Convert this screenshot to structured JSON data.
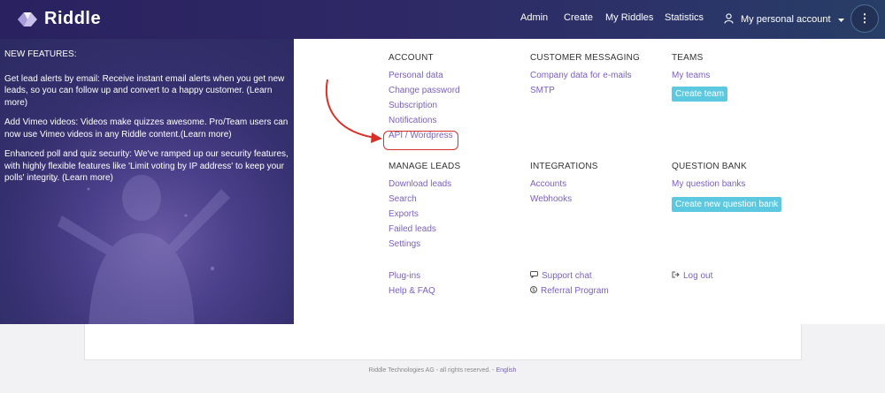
{
  "header": {
    "brand": "Riddle",
    "nav": [
      "Admin",
      "Create",
      "My Riddles",
      "Statistics"
    ],
    "account_label": "My personal account",
    "more_icon": "⋮"
  },
  "promo": {
    "title": "NEW FEATURES:",
    "items": [
      "Get lead alerts by email: Receive instant email alerts when you get new leads, so you can follow up and convert to a happy customer. (Learn more)",
      "Add Vimeo videos: Videos make quizzes awesome. Pro/Team users can now use Vimeo videos in any Riddle content.(Learn more)",
      "Enhanced poll and quiz security: We've ramped up our security features, with highly flexible features like 'Limit voting by IP address' to keep your polls' integrity. (Learn more)"
    ]
  },
  "menu": {
    "account": {
      "title": "ACCOUNT",
      "links": [
        "Personal data",
        "Change password",
        "Subscription",
        "Notifications",
        "API / Wordpress"
      ]
    },
    "messaging": {
      "title": "CUSTOMER MESSAGING",
      "links": [
        "Company data for e-mails",
        "SMTP"
      ]
    },
    "teams": {
      "title": "TEAMS",
      "links": [
        "My teams"
      ],
      "button": "Create team"
    },
    "leads": {
      "title": "MANAGE LEADS",
      "links": [
        "Download leads",
        "Search",
        "Exports",
        "Failed leads",
        "Settings"
      ]
    },
    "integrations": {
      "title": "INTEGRATIONS",
      "links": [
        "Accounts",
        "Webhooks"
      ]
    },
    "question_bank": {
      "title": "QUESTION BANK",
      "links": [
        "My question banks"
      ],
      "button": "Create new question bank"
    },
    "bottom": {
      "plugins": "Plug-ins",
      "help": "Help & FAQ",
      "support": "Support chat",
      "referral": "Referral Program",
      "logout": "Log out"
    }
  },
  "footer": {
    "text": "Riddle Technologies AG - all rights reserved. -",
    "language": "English"
  },
  "colors": {
    "accent_link": "#7a5fc4",
    "button_teal": "#5cc9e0",
    "annotation_red": "#d9312a"
  }
}
